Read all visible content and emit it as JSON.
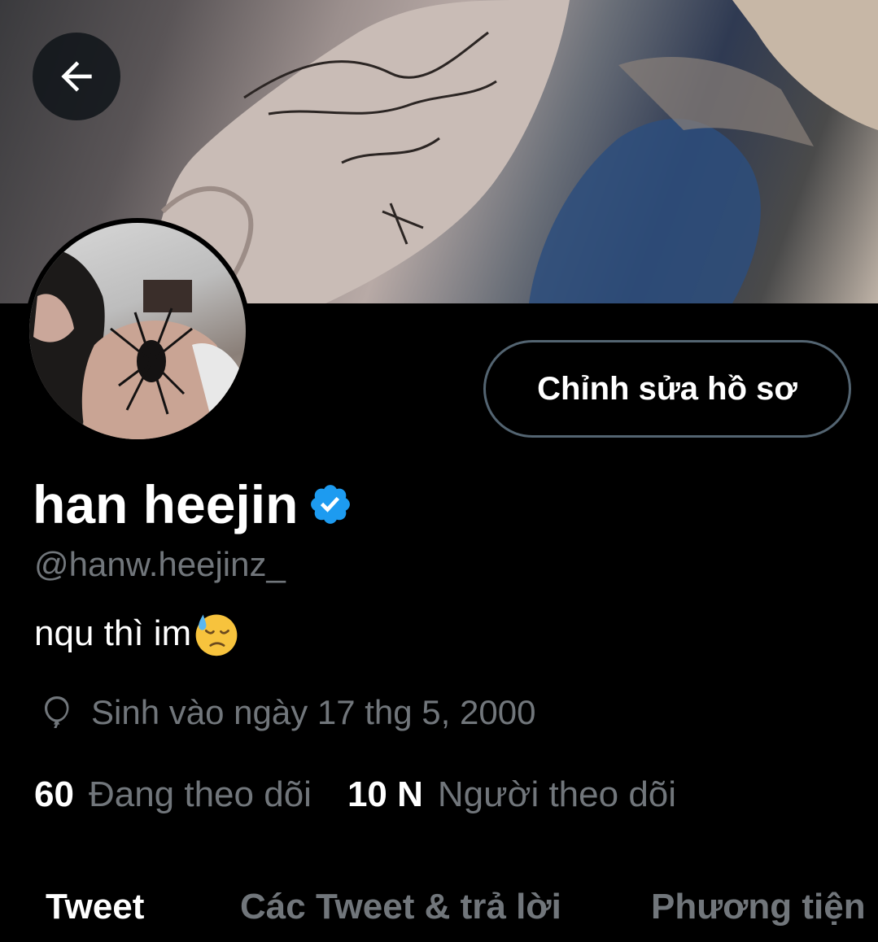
{
  "header": {
    "back_icon": "arrow-left-icon"
  },
  "profile": {
    "display_name": "han heejin",
    "verified_icon": "verified-badge-icon",
    "verified_color": "#1d9bf0",
    "handle": "@hanw.heejinz_",
    "bio_text": "nqu thì im",
    "bio_emoji": "downcast-face-with-sweat-emoji",
    "birth_icon": "balloon-icon",
    "birth_text": "Sinh vào ngày 17 thg 5, 2000",
    "edit_button_label": "Chỉnh sửa hồ sơ"
  },
  "stats": {
    "following_count": "60",
    "following_label": "Đang theo dõi",
    "followers_count": "10 N",
    "followers_label": "Người theo dõi"
  },
  "tabs": [
    {
      "label": "Tweet",
      "active": true
    },
    {
      "label": "Các Tweet & trả lời",
      "active": false
    },
    {
      "label": "Phương tiện",
      "active": false
    }
  ],
  "colors": {
    "background": "#000000",
    "primary_text": "#ffffff",
    "secondary_text": "#71767b",
    "button_border": "#536471",
    "accent": "#1d9bf0"
  }
}
